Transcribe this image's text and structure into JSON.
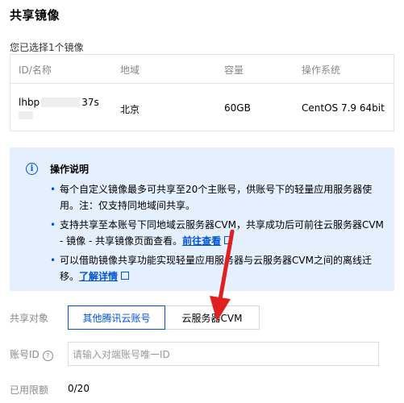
{
  "dialog": {
    "title": "共享镜像",
    "selected_count_text": "您已选择1个镜像"
  },
  "table": {
    "headers": [
      "ID/名称",
      "地域",
      "容量",
      "操作系统"
    ],
    "row": {
      "id_prefix": "lhbp",
      "id_suffix": "37s",
      "region": "北京",
      "capacity": "60GB",
      "os": "CentOS 7.9 64bit"
    }
  },
  "instructions": {
    "title": "操作说明",
    "bullet1": "每个自定义镜像最多可共享至20个主账号，供账号下的轻量应用服务器使用。注：仅支持同地域间共享。",
    "bullet2_text": "支持共享至本账号下同地域云服务器CVM，共享成功后可前往云服务器CVM - 镜像 - 共享镜像页面查看。",
    "bullet2_link": "前往查看",
    "bullet3_text": "可以借助镜像共享功能实现轻量应用服务器与云服务器CVM之间的离线迁移。",
    "bullet3_link": "了解详情",
    "bullet_dot": "•",
    "info_glyph": "i"
  },
  "form": {
    "share_target_label": "共享对象",
    "option_tencent": "其他腾讯云账号",
    "option_cvm": "云服务器CVM",
    "selected_option": "其他腾讯云账号",
    "account_id_label": "账号ID",
    "account_id_placeholder": "请输入对端账号唯一ID",
    "quota_label": "已用限额",
    "quota_value": "0/20"
  },
  "colors": {
    "accent": "#0052d9",
    "info_bg": "#e5f0ff",
    "annotation_arrow": "#e02020"
  },
  "icons": {
    "info": "info-circle-icon",
    "help": "help-circle-icon",
    "external": "external-link-icon",
    "annotation": "red-arrow-annotation"
  }
}
